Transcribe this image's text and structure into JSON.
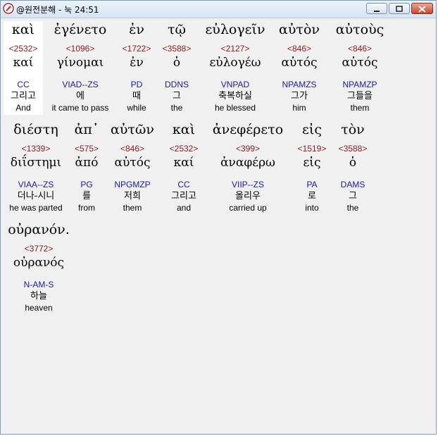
{
  "window": {
    "title": "@원전분해 - 눅 24:51"
  },
  "words": [
    {
      "greek": "καὶ",
      "strong": "<2532>",
      "lemma": "καί",
      "morph": "CC",
      "korean": "그리고",
      "english": "And"
    },
    {
      "greek": "ἐγένετο",
      "strong": "<1096>",
      "lemma": "γίνομαι",
      "morph": "VIAD--ZS",
      "korean": "에",
      "english": "it came to pass"
    },
    {
      "greek": "ἐν",
      "strong": "<1722>",
      "lemma": "ἐν",
      "morph": "PD",
      "korean": "때",
      "english": "while"
    },
    {
      "greek": "τῷ",
      "strong": "<3588>",
      "lemma": "ὁ",
      "morph": "DDNS",
      "korean": "그",
      "english": "the"
    },
    {
      "greek": "εὐλογεῖν",
      "strong": "<2127>",
      "lemma": "εὐλογέω",
      "morph": "VNPAD",
      "korean": "축복하실",
      "english": "he blessed"
    },
    {
      "greek": "αὐτὸν",
      "strong": "<846>",
      "lemma": "αὐτός",
      "morph": "NPAMZS",
      "korean": "그가",
      "english": "him"
    },
    {
      "greek": "αὐτοὺς",
      "strong": "<846>",
      "lemma": "αὐτός",
      "morph": "NPAMZP",
      "korean": "그들을",
      "english": "them"
    },
    {
      "greek": "διέστη",
      "strong": "<1339>",
      "lemma": "διΐστημι",
      "morph": "VIAA--ZS",
      "korean": "더나-시니",
      "english": "he was parted"
    },
    {
      "greek": "ἀπ᾽",
      "strong": "<575>",
      "lemma": "ἀπό",
      "morph": "PG",
      "korean": "를",
      "english": "from"
    },
    {
      "greek": "αὐτῶν",
      "strong": "<846>",
      "lemma": "αὐτός",
      "morph": "NPGMZP",
      "korean": "저희",
      "english": "them"
    },
    {
      "greek": "καὶ",
      "strong": "<2532>",
      "lemma": "καί",
      "morph": "CC",
      "korean": "그리고",
      "english": "and"
    },
    {
      "greek": "ἀνεφέρετο",
      "strong": "<399>",
      "lemma": "ἀναφέρω",
      "morph": "VIIP--ZS",
      "korean": "올리우",
      "english": "carried up"
    },
    {
      "greek": "εἰς",
      "strong": "<1519>",
      "lemma": "εἰς",
      "morph": "PA",
      "korean": "로",
      "english": "into"
    },
    {
      "greek": "τὸν",
      "strong": "<3588>",
      "lemma": "ὁ",
      "morph": "DAMS",
      "korean": "그",
      "english": "the"
    },
    {
      "greek": "οὐρανόν.",
      "strong": "<3772>",
      "lemma": "οὐρανός",
      "morph": "N-AM-S",
      "korean": "하늘",
      "english": "heaven"
    }
  ],
  "colors": {
    "strong": "#8b1a1a",
    "morph": "#1a1aa8"
  },
  "icons": {
    "app": "bible-app-icon",
    "minimize": "minimize-icon",
    "maximize": "maximize-icon",
    "close": "close-icon"
  }
}
